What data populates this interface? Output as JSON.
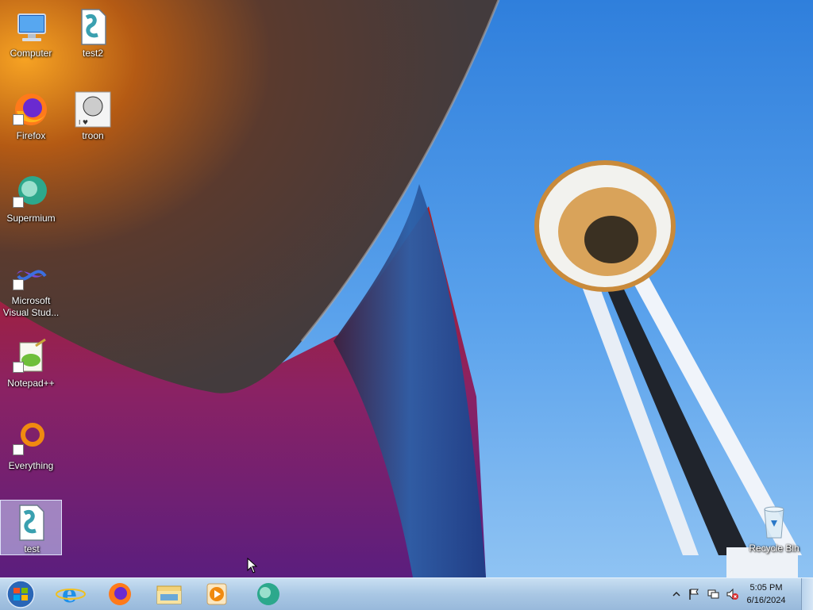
{
  "desktop_icons": [
    {
      "name": "computer",
      "label": "Computer"
    },
    {
      "name": "test2",
      "label": "test2"
    },
    {
      "name": "firefox",
      "label": "Firefox"
    },
    {
      "name": "troon",
      "label": "troon"
    },
    {
      "name": "supermium",
      "label": "Supermium"
    },
    {
      "name": "visual-studio",
      "label": "Microsoft Visual Stud..."
    },
    {
      "name": "notepadpp",
      "label": "Notepad++"
    },
    {
      "name": "everything",
      "label": "Everything"
    },
    {
      "name": "test",
      "label": "test",
      "selected": true
    },
    {
      "name": "recycle-bin",
      "label": "Recycle Bin"
    }
  ],
  "taskbar": {
    "pinned": [
      "internet-explorer-icon",
      "firefox-icon",
      "file-explorer-icon",
      "media-player-icon",
      "supermium-icon"
    ],
    "clock": {
      "time": "5:05 PM",
      "date": "6/16/2024"
    },
    "tray_icons": [
      "show-hidden-icons",
      "action-center-flag-icon",
      "network-icon",
      "volume-muted-icon"
    ]
  },
  "colors": {
    "sky": "#3a86dd",
    "taskbar": "#b4cfe8",
    "selection": "#cdd7ff"
  }
}
